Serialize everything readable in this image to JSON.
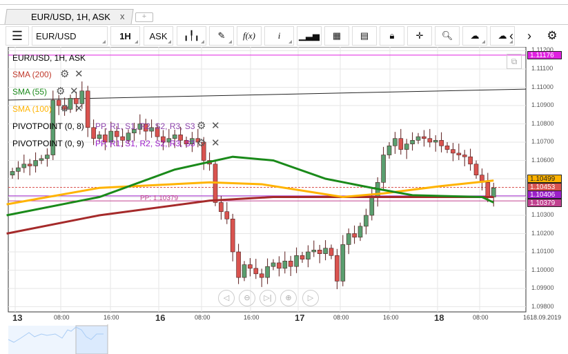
{
  "tab": {
    "title": "EUR/USD, 1H, ASK",
    "close": "x",
    "add": "+"
  },
  "toolbar": {
    "menu": "☰",
    "symbol": "EUR/USD",
    "period": "1H",
    "side": "ASK",
    "fx": "f(x)",
    "info": "i"
  },
  "legend": {
    "title": "EUR/USD, 1H, ASK",
    "sma200": "SMA (200)",
    "sma55": "SMA (55)",
    "sma100": "SMA (100)",
    "pivot1": "PIVOTPOINT (0, 8)",
    "pivot1_levels": "PP, R1, S1, R2, S2, R3, S3",
    "pivot2": "PIVOTPOINT (0, 9)",
    "pivot2_levels": "PP, R1, S1, R2, S2, R3, S3"
  },
  "pp_label": "PP: 1.10379",
  "price_axis": [
    "1.11200",
    "1.11100",
    "1.11000",
    "1.10900",
    "1.10800",
    "1.10700",
    "1.10600",
    "1.10500",
    "1.10400",
    "1.10300",
    "1.10200",
    "1.10100",
    "1.10000",
    "1.09900",
    "1.09800"
  ],
  "price_badges": [
    {
      "value": "1.11176",
      "color": "#e020e0",
      "text": "#fff"
    },
    {
      "value": "1.10499",
      "color": "#ffb300",
      "text": "#222"
    },
    {
      "value": "1.10453",
      "color": "#d9534f",
      "text": "#fff"
    },
    {
      "value": "1.10406",
      "color": "#9c1fc9",
      "text": "#fff"
    },
    {
      "value": "1.10379",
      "color": "#c0418f",
      "text": "#fff"
    }
  ],
  "time_axis": [
    {
      "label": "13",
      "bold": true
    },
    {
      "label": "08:00"
    },
    {
      "label": "16:00"
    },
    {
      "label": "16",
      "bold": true
    },
    {
      "label": "08:00"
    },
    {
      "label": "16:00"
    },
    {
      "label": "17",
      "bold": true
    },
    {
      "label": "08:00"
    },
    {
      "label": "16:00"
    },
    {
      "label": "18",
      "bold": true
    },
    {
      "label": "08:00"
    },
    {
      "label": "1618.09.2019"
    }
  ],
  "closes": [
    1.1054,
    1.1056,
    1.1058,
    1.1057,
    1.106,
    1.1061,
    1.1063,
    1.1093,
    1.109,
    1.1088,
    1.1094,
    1.1091,
    1.1098,
    1.1078,
    1.1072,
    1.1074,
    1.107,
    1.1076,
    1.1073,
    1.1071,
    1.1075,
    1.1077,
    1.108,
    1.1076,
    1.1078,
    1.1073,
    1.107,
    1.1072,
    1.1074,
    1.1071,
    1.1069,
    1.1072,
    1.107,
    1.106,
    1.1058,
    1.1037,
    1.1032,
    1.1028,
    1.101,
    1.0996,
    1.1003,
    1.1001,
    1.0998,
    1.0996,
    1.1002,
    1.1004,
    1.1001,
    1.1005,
    1.1002,
    1.1008,
    1.1006,
    1.101,
    1.1011,
    1.1009,
    1.1012,
    1.1008,
    1.0994,
    1.1014,
    1.102,
    1.1018,
    1.1024,
    1.103,
    1.104,
    1.1048,
    1.1063,
    1.1068,
    1.1072,
    1.1066,
    1.1069,
    1.1071,
    1.1073,
    1.1072,
    1.107,
    1.1071,
    1.1068,
    1.1066,
    1.1064,
    1.1063,
    1.1062,
    1.1058,
    1.1052,
    1.1048,
    1.104,
    1.1045
  ],
  "sma55": [
    [
      -1,
      1.103
    ],
    [
      15,
      1.104
    ],
    [
      28,
      1.1055
    ],
    [
      38,
      1.1062
    ],
    [
      45,
      1.106
    ],
    [
      54,
      1.105
    ],
    [
      62,
      1.1045
    ],
    [
      69,
      1.1041
    ],
    [
      81,
      1.104
    ],
    [
      83,
      1.1037
    ]
  ],
  "sma100": [
    [
      -1,
      1.1036
    ],
    [
      15,
      1.1045
    ],
    [
      34,
      1.1048
    ],
    [
      43,
      1.1047
    ],
    [
      57,
      1.104
    ],
    [
      64,
      1.1042
    ],
    [
      74,
      1.1046
    ],
    [
      83,
      1.1049
    ]
  ],
  "sma200": [
    [
      -1,
      1.102
    ],
    [
      15,
      1.103
    ],
    [
      34,
      1.1038
    ],
    [
      45,
      1.104
    ],
    [
      83,
      1.104
    ]
  ],
  "colors": {
    "up": "#5a9e6f",
    "down": "#d9534f",
    "sma55": "#1a8a1a",
    "sma100": "#ffb300",
    "sma200": "#a52a2a"
  }
}
